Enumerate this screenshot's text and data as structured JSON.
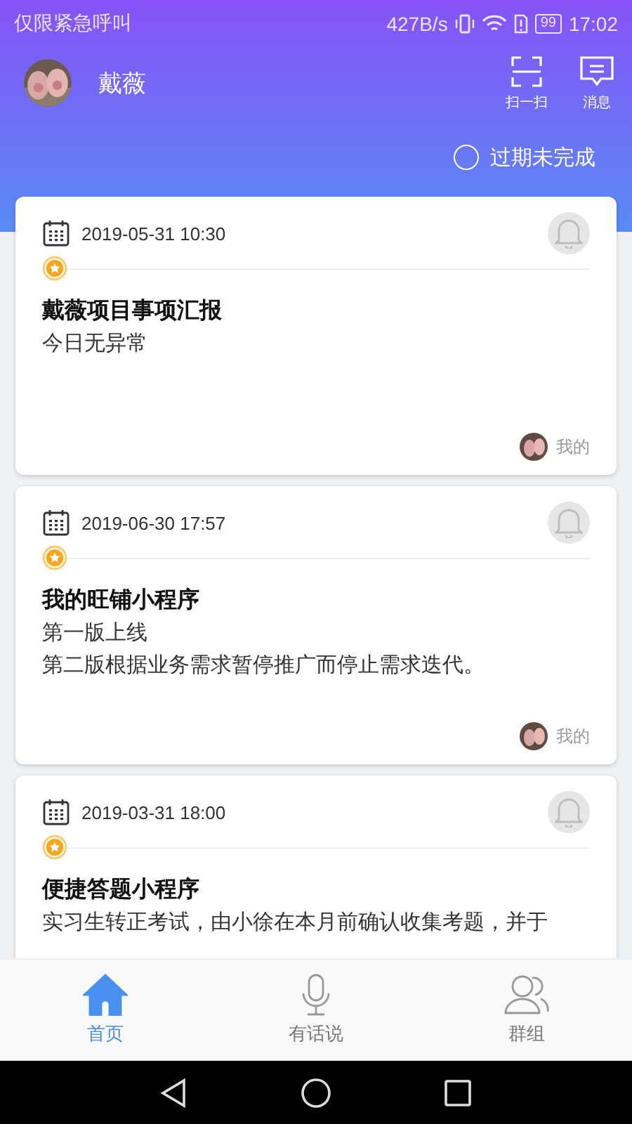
{
  "status_bar": {
    "left": "仅限紧急呼叫",
    "speed": "427B/s",
    "battery": "99",
    "time": "17:02"
  },
  "header": {
    "user_name": "戴薇",
    "actions": [
      {
        "kind": "scan",
        "label": "扫一扫"
      },
      {
        "kind": "message",
        "label": "消息"
      }
    ]
  },
  "filter": {
    "label": "过期未完成",
    "checked": false
  },
  "cards": [
    {
      "date": "2019-05-31 10:30",
      "title": "戴薇项目事项汇报",
      "body": [
        "今日无异常"
      ],
      "owner": "我的"
    },
    {
      "date": "2019-06-30 17:57",
      "title": "我的旺铺小程序",
      "body": [
        "第一版上线",
        "第二版根据业务需求暂停推广而停止需求迭代。"
      ],
      "owner": "我的"
    },
    {
      "date": "2019-03-31 18:00",
      "title": "便捷答题小程序",
      "body": [
        "实习生转正考试，由小徐在本月前确认收集考题，并于"
      ]
    }
  ],
  "tab_bar": [
    {
      "kind": "home",
      "label": "首页",
      "selected": true
    },
    {
      "kind": "mic",
      "label": "有话说",
      "selected": false
    },
    {
      "kind": "group",
      "label": "群组",
      "selected": false
    }
  ]
}
